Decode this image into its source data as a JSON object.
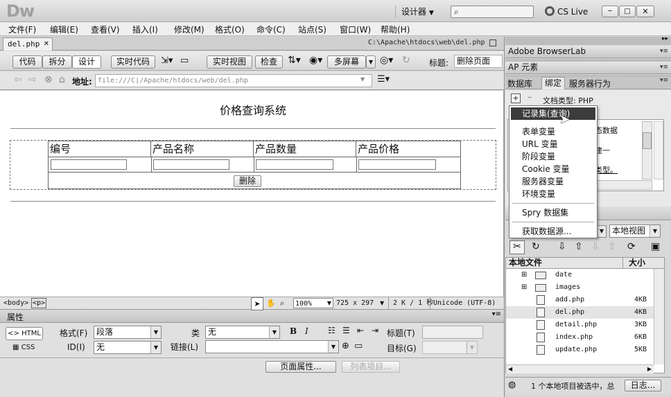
{
  "app": {
    "logo": "Dw",
    "workspace": "设计器",
    "search_placeholder": "",
    "cs_live": "CS Live"
  },
  "menu": [
    "文件(F)",
    "编辑(E)",
    "查看(V)",
    "插入(I)",
    "修改(M)",
    "格式(O)",
    "命令(C)",
    "站点(S)",
    "窗口(W)",
    "帮助(H)"
  ],
  "doc": {
    "tab": "del.php",
    "path": "C:\\Apache\\htdocs\\web\\del.php"
  },
  "toolbar": {
    "code": "代码",
    "split": "拆分",
    "design": "设计",
    "live_code": "实时代码",
    "live_view": "实时视图",
    "inspect": "检查",
    "multiscreen": "多屏幕",
    "title_label": "标题:",
    "title_value": "删除页面"
  },
  "address": {
    "label": "地址:",
    "value": "file:///C|/Apache/htdocs/web/del.php"
  },
  "page": {
    "heading": "价格查询系统",
    "columns": [
      "编号",
      "产品名称",
      "产品数量",
      "产品价格"
    ],
    "delete_btn": "删除"
  },
  "status": {
    "tags": [
      "<body>",
      "<p>"
    ],
    "zoom": "100%",
    "size": "725 x 297",
    "download": "2 K / 1 秒",
    "encoding": "Unicode (UTF-8)"
  },
  "props": {
    "title": "属性",
    "html": "HTML",
    "css": "CSS",
    "format_label": "格式(F)",
    "format_value": "段落",
    "class_label": "类",
    "class_value": "无",
    "id_label": "ID(I)",
    "id_value": "无",
    "link_label": "链接(L)",
    "title_label": "标题(T)",
    "target_label": "目标(G)",
    "bold": "B",
    "italic": "I",
    "page_props": "页面属性...",
    "list_item": "列表项目..."
  },
  "right": {
    "browserlab": "Adobe BrowserLab",
    "ap": "AP 元素",
    "tabs": [
      "数据库",
      "绑定",
      "服务器行为"
    ],
    "doc_type": "文档类型: PHP",
    "bg_text": [
      "态数据",
      "建一",
      "类型。"
    ],
    "dropdown": [
      "记录集(查询)",
      "表单变量",
      "URL 变量",
      "阶段变量",
      "Cookie 变量",
      "服务器变量",
      "环境变量",
      "Spry 数据集",
      "获取数据源..."
    ],
    "files_view": "本地视图",
    "files_header": [
      "本地文件",
      "大小"
    ],
    "files": [
      {
        "name": "date",
        "size": "",
        "type": "folder"
      },
      {
        "name": "images",
        "size": "",
        "type": "folder"
      },
      {
        "name": "add.php",
        "size": "4KB",
        "type": "file"
      },
      {
        "name": "del.php",
        "size": "4KB",
        "type": "file"
      },
      {
        "name": "detail.php",
        "size": "3KB",
        "type": "file"
      },
      {
        "name": "index.php",
        "size": "6KB",
        "type": "file"
      },
      {
        "name": "update.php",
        "size": "5KB",
        "type": "file"
      }
    ],
    "footer": "1 个本地项目被选中，总",
    "log_btn": "日志..."
  }
}
